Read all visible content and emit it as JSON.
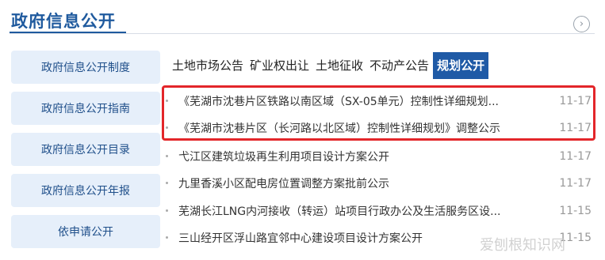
{
  "header": {
    "title": "政府信息公开",
    "more_icon": "chevron-right-circle-icon"
  },
  "sidebar": {
    "items": [
      {
        "label": "政府信息公开制度"
      },
      {
        "label": "政府信息公开指南"
      },
      {
        "label": "政府信息公开目录"
      },
      {
        "label": "政府信息公开年报"
      },
      {
        "label": "依申请公开"
      }
    ]
  },
  "tabs": [
    {
      "label": "土地市场公告",
      "active": false
    },
    {
      "label": "矿业权出让",
      "active": false
    },
    {
      "label": "土地征收",
      "active": false
    },
    {
      "label": "不动产公告",
      "active": false
    },
    {
      "label": "规划公开",
      "active": true
    }
  ],
  "news": [
    {
      "title": "《芜湖市沈巷片区铁路以南区域（SX-05单元）控制性详细规划...",
      "date": "11-17"
    },
    {
      "title": "《芜湖市沈巷片区（长河路以北区域）控制性详细规划》调整公示",
      "date": "11-17"
    },
    {
      "title": "弋江区建筑垃圾再生利用项目设计方案公开",
      "date": "11-17"
    },
    {
      "title": "九里香溪小区配电房位置调整方案批前公示",
      "date": "11-17"
    },
    {
      "title": "芜湖长江LNG内河接收（转运）站项目行政办公及生活服务区设...",
      "date": "11-15"
    },
    {
      "title": "三山经开区浮山路宜邻中心建设项目设计方案公开",
      "date": "11-15"
    }
  ],
  "highlight_color": "#e3262a",
  "accent_color": "#1f5aa6",
  "watermark": "爱刨根知识网"
}
